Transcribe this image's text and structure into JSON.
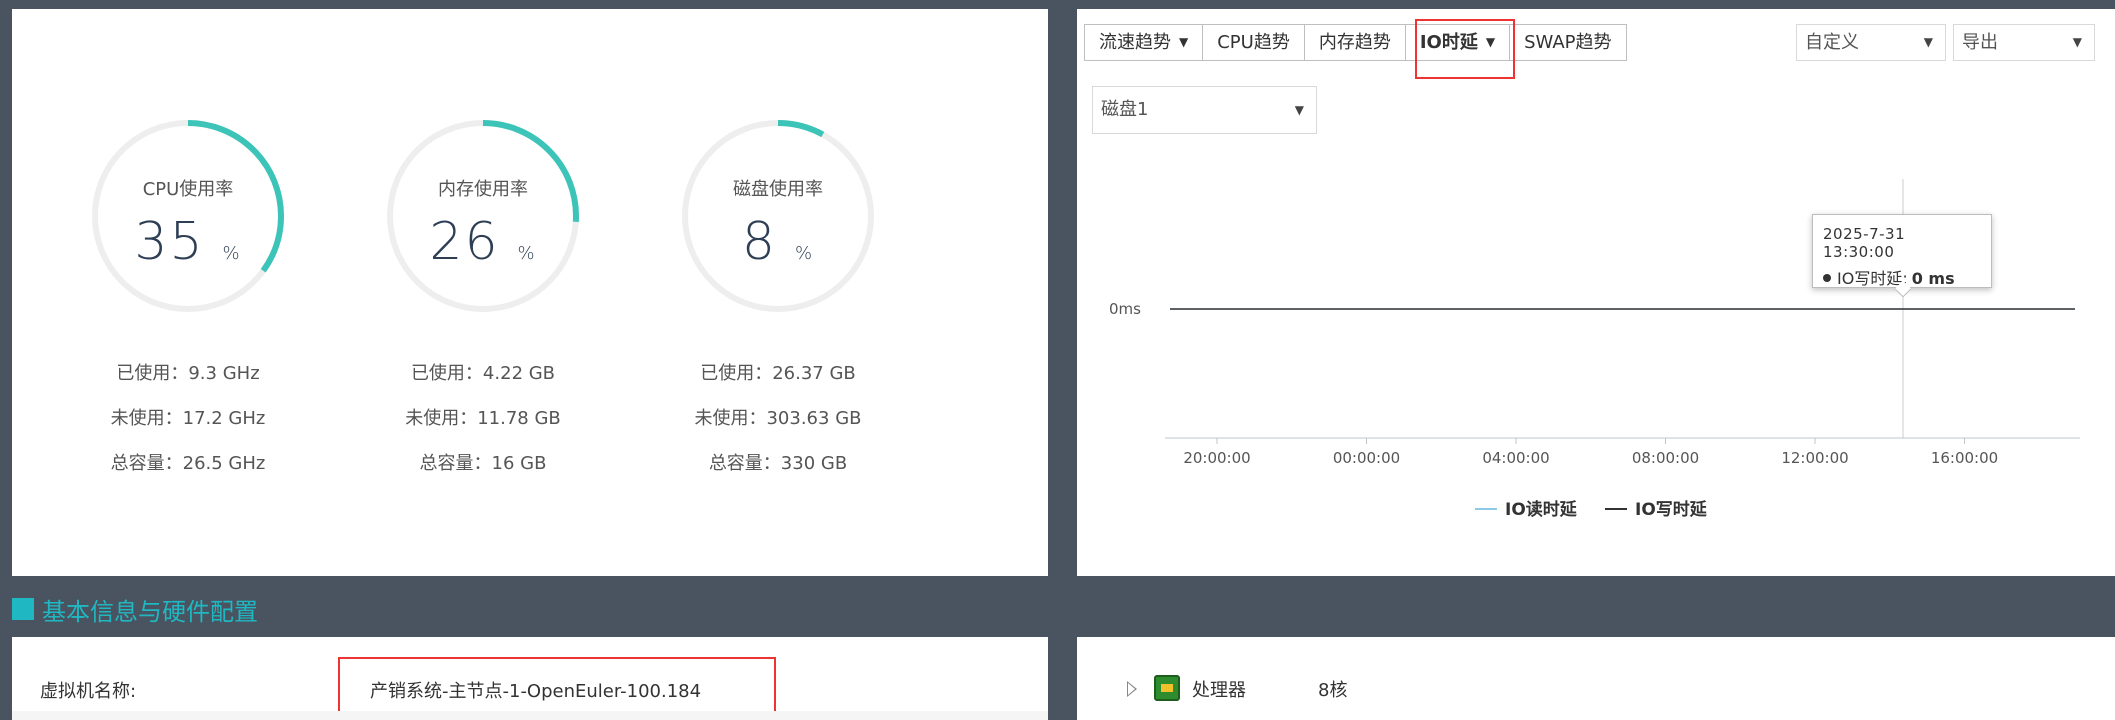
{
  "gauges": [
    {
      "title": "CPU使用率",
      "value": 35,
      "unit": "%",
      "used": "已使用：9.3 GHz",
      "free": "未使用：17.2 GHz",
      "total": "总容量：26.5 GHz"
    },
    {
      "title": "内存使用率",
      "value": 26,
      "unit": "%",
      "used": "已使用：4.22 GB",
      "free": "未使用：11.78 GB",
      "total": "总容量：16 GB"
    },
    {
      "title": "磁盘使用率",
      "value": 8,
      "unit": "%",
      "used": "已使用：26.37 GB",
      "free": "未使用：303.63 GB",
      "total": "总容量：330 GB"
    }
  ],
  "colors": {
    "accent": "#3cc4b8",
    "track": "#eeeeee",
    "highlight": "#e33333",
    "section": "#1fb8c2"
  },
  "trend": {
    "tabs": [
      {
        "label": "流速趋势",
        "caret": "▼"
      },
      {
        "label": "CPU趋势"
      },
      {
        "label": "内存趋势"
      },
      {
        "label": "IO时延",
        "caret": "▼"
      },
      {
        "label": "SWAP趋势"
      }
    ],
    "range_select": "自定义",
    "export_select": "导出",
    "disk_select": "磁盘1",
    "caret": "▼"
  },
  "chart_data": {
    "type": "line",
    "ylabel": "",
    "y_ticks": [
      "0ms"
    ],
    "x_ticks": [
      "20:00:00",
      "00:00:00",
      "04:00:00",
      "08:00:00",
      "12:00:00",
      "16:00:00"
    ],
    "series": [
      {
        "name": "IO读时延",
        "color": "#8ec9e8",
        "values": [
          0,
          0,
          0,
          0,
          0,
          0
        ]
      },
      {
        "name": "IO写时延",
        "color": "#333333",
        "values": [
          0,
          0,
          0,
          0,
          0,
          0
        ]
      }
    ],
    "tooltip": {
      "time": "2025-7-31 13:30:00",
      "series": "IO写时延:",
      "value": "0 ms"
    },
    "grid": false,
    "legend_position": "bottom"
  },
  "section": {
    "title": "基本信息与硬件配置"
  },
  "vm_info": {
    "label": "虚拟机名称:",
    "value": "产销系统-主节点-1-OpenEuler-100.184"
  },
  "hardware": {
    "label": "处理器",
    "value": "8核"
  }
}
